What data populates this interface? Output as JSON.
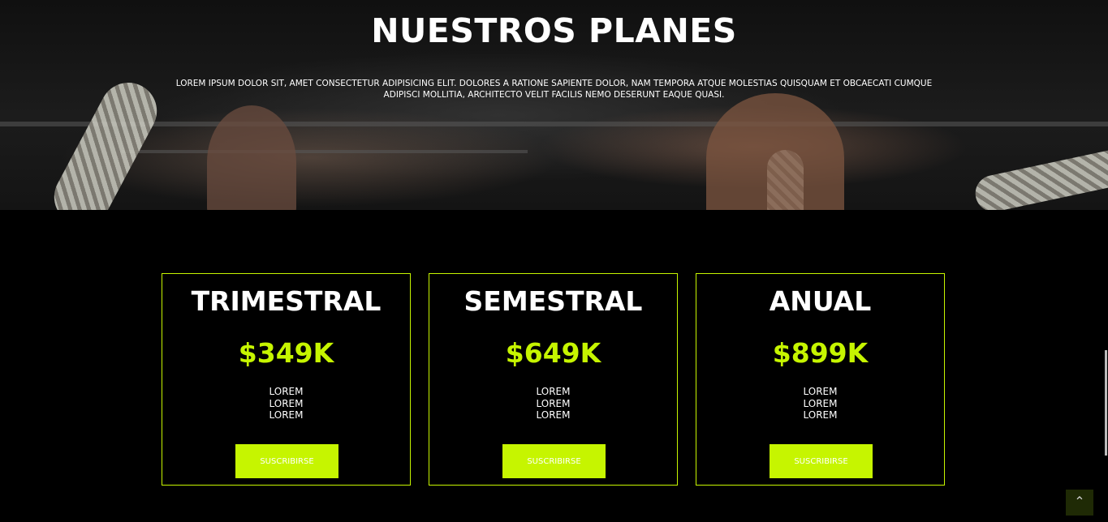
{
  "hero": {
    "title": "NUESTROS PLANES",
    "description": "LOREM IPSUM DOLOR SIT, AMET CONSECTETUR ADIPISICING ELIT. DOLORES A RATIONE SAPIENTE DOLOR, NAM TEMPORA ATQUE MOLESTIAS QUISQUAM ET OBCAECATI CUMQUE ADIPISCI MOLLITIA, ARCHITECTO VELIT FACILIS NEMO DESERUNT EAQUE QUASI."
  },
  "plans": [
    {
      "name": "TRIMESTRAL",
      "price": "$349K",
      "features": [
        "LOREM",
        "LOREM",
        "LOREM"
      ],
      "button_label": "SUSCRIBIRSE"
    },
    {
      "name": "SEMESTRAL",
      "price": "$649K",
      "features": [
        "LOREM",
        "LOREM",
        "LOREM"
      ],
      "button_label": "SUSCRIBIRSE"
    },
    {
      "name": "ANUAL",
      "price": "$899K",
      "features": [
        "LOREM",
        "LOREM",
        "LOREM"
      ],
      "button_label": "SUSCRIBIRSE"
    }
  ],
  "back_to_top": {
    "icon": "chevron-up-icon",
    "glyph": "⌃"
  },
  "colors": {
    "accent": "#c6f500",
    "background": "#000000",
    "text": "#ffffff"
  }
}
